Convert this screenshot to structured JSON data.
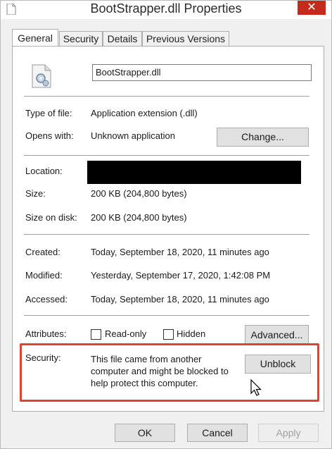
{
  "window": {
    "title": "BootStrapper.dll Properties",
    "close_glyph": "✕"
  },
  "tabs": [
    {
      "label": "General",
      "active": true
    },
    {
      "label": "Security",
      "active": false
    },
    {
      "label": "Details",
      "active": false
    },
    {
      "label": "Previous Versions",
      "active": false
    }
  ],
  "general": {
    "file_name": "BootStrapper.dll",
    "type_label": "Type of file:",
    "type_value": "Application extension (.dll)",
    "opens_label": "Opens with:",
    "opens_value": "Unknown application",
    "change_button": "Change...",
    "location_label": "Location:",
    "size_label": "Size:",
    "size_value": "200 KB (204,800 bytes)",
    "size_on_disk_label": "Size on disk:",
    "size_on_disk_value": "200 KB (204,800 bytes)",
    "created_label": "Created:",
    "created_value": "Today, September 18, 2020, 11 minutes ago",
    "modified_label": "Modified:",
    "modified_value": "Yesterday, September 17, 2020, 1:42:08 PM",
    "accessed_label": "Accessed:",
    "accessed_value": "Today, September 18, 2020, 11 minutes ago",
    "attributes_label": "Attributes:",
    "readonly_label": "Read-only",
    "readonly_checked": false,
    "hidden_label": "Hidden",
    "hidden_checked": false,
    "advanced_button": "Advanced...",
    "security_label": "Security:",
    "security_text_1": "This file came from another",
    "security_text_2": "computer and might be blocked to",
    "security_text_3": "help protect this computer.",
    "unblock_button": "Unblock"
  },
  "footer": {
    "ok_button": "OK",
    "cancel_button": "Cancel",
    "apply_button": "Apply"
  },
  "colors": {
    "highlight_border": "#d9452f",
    "close_button": "#c42b1c"
  }
}
